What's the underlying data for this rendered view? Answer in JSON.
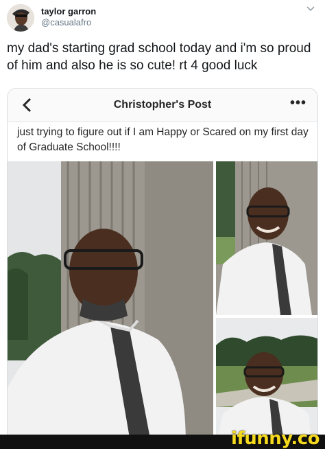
{
  "tweet": {
    "author_name": "taylor garron",
    "author_handle": "@casualafro",
    "text": "my dad's starting grad school today and i'm so proud of him and also he is so cute! rt 4 good luck"
  },
  "post_card": {
    "title": "Christopher's Post",
    "more_label": "•••",
    "caption": "just trying to figure out if I am Happy or Scared on my first day of Graduate School!!!!"
  },
  "watermark": {
    "text": "ifunny.co",
    "color": "#f5d91c"
  },
  "icons": {
    "back": "chevron-left-icon",
    "menu": "chevron-down-icon"
  },
  "colors": {
    "text_primary": "#14171a",
    "text_secondary": "#657786",
    "card_border": "#d8dde1"
  }
}
